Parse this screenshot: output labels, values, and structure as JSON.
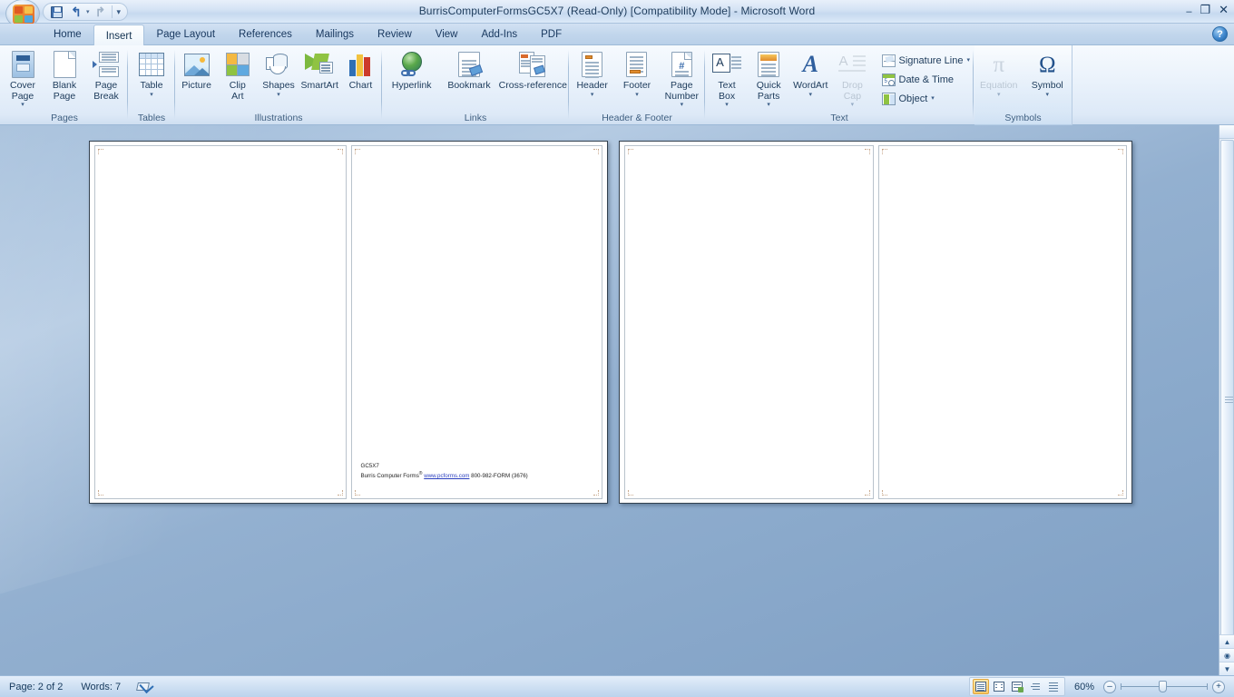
{
  "window": {
    "title": "BurrisComputerFormsGC5X7 (Read-Only) [Compatibility Mode] - Microsoft Word",
    "minimize": "–",
    "restore": "❐",
    "close": "✕",
    "help": "?"
  },
  "quick_access": {
    "save": "save-icon",
    "undo": "↰",
    "redo": "↱",
    "customize": "▾"
  },
  "tabs": [
    {
      "label": "Home",
      "active": false
    },
    {
      "label": "Insert",
      "active": true
    },
    {
      "label": "Page Layout",
      "active": false
    },
    {
      "label": "References",
      "active": false
    },
    {
      "label": "Mailings",
      "active": false
    },
    {
      "label": "Review",
      "active": false
    },
    {
      "label": "View",
      "active": false
    },
    {
      "label": "Add-Ins",
      "active": false
    },
    {
      "label": "PDF",
      "active": false
    }
  ],
  "ribbon": {
    "groups": [
      {
        "name": "Pages",
        "label": "Pages",
        "buttons": [
          {
            "label": "Cover\nPage",
            "dropdown": true,
            "disabled": false
          },
          {
            "label": "Blank\nPage",
            "dropdown": false,
            "disabled": false
          },
          {
            "label": "Page\nBreak",
            "dropdown": false,
            "disabled": false
          }
        ]
      },
      {
        "name": "Tables",
        "label": "Tables",
        "buttons": [
          {
            "label": "Table",
            "dropdown": true,
            "disabled": false
          }
        ]
      },
      {
        "name": "Illustrations",
        "label": "Illustrations",
        "buttons": [
          {
            "label": "Picture",
            "dropdown": false,
            "disabled": false
          },
          {
            "label": "Clip\nArt",
            "dropdown": false,
            "disabled": false
          },
          {
            "label": "Shapes",
            "dropdown": true,
            "disabled": false
          },
          {
            "label": "SmartArt",
            "dropdown": false,
            "disabled": false
          },
          {
            "label": "Chart",
            "dropdown": false,
            "disabled": false
          }
        ]
      },
      {
        "name": "Links",
        "label": "Links",
        "buttons": [
          {
            "label": "Hyperlink",
            "dropdown": false,
            "disabled": false
          },
          {
            "label": "Bookmark",
            "dropdown": false,
            "disabled": false
          },
          {
            "label": "Cross-reference",
            "dropdown": false,
            "disabled": false
          }
        ]
      },
      {
        "name": "Header & Footer",
        "label": "Header & Footer",
        "buttons": [
          {
            "label": "Header",
            "dropdown": true,
            "disabled": false
          },
          {
            "label": "Footer",
            "dropdown": true,
            "disabled": false
          },
          {
            "label": "Page\nNumber",
            "dropdown": true,
            "disabled": false
          }
        ]
      },
      {
        "name": "Text",
        "label": "Text",
        "buttons": [
          {
            "label": "Text\nBox",
            "dropdown": true,
            "disabled": false
          },
          {
            "label": "Quick\nParts",
            "dropdown": true,
            "disabled": false
          },
          {
            "label": "WordArt",
            "dropdown": true,
            "disabled": false
          },
          {
            "label": "Drop\nCap",
            "dropdown": true,
            "disabled": true
          }
        ],
        "small_buttons": [
          {
            "label": "Signature Line",
            "dropdown": true
          },
          {
            "label": "Date & Time",
            "dropdown": false
          },
          {
            "label": "Object",
            "dropdown": true
          }
        ]
      },
      {
        "name": "Symbols",
        "label": "Symbols",
        "buttons": [
          {
            "label": "Equation",
            "glyph": "π",
            "dropdown": true,
            "disabled": true
          },
          {
            "label": "Symbol",
            "glyph": "Ω",
            "dropdown": true,
            "disabled": false
          }
        ]
      }
    ]
  },
  "document": {
    "form_code": "GC5X7",
    "company": "Burris Computer Forms",
    "registered_mark": "®",
    "website": "www.pcforms.com",
    "phone": "800-982-FORM (3676)"
  },
  "status_bar": {
    "page": "Page: 2 of 2",
    "words": "Words: 7",
    "proofing_icon": "proofing-errors-icon",
    "zoom": "60%",
    "zoom_out": "–",
    "zoom_in": "+",
    "views": [
      {
        "name": "print-layout",
        "selected": true
      },
      {
        "name": "full-screen-reading",
        "selected": false
      },
      {
        "name": "web-layout",
        "selected": false
      },
      {
        "name": "outline",
        "selected": false
      },
      {
        "name": "draft",
        "selected": false
      }
    ]
  },
  "scrollbar": {
    "up": "▲",
    "previous_page": "▲",
    "select_browse_object": "◉",
    "next_page": "▼"
  }
}
